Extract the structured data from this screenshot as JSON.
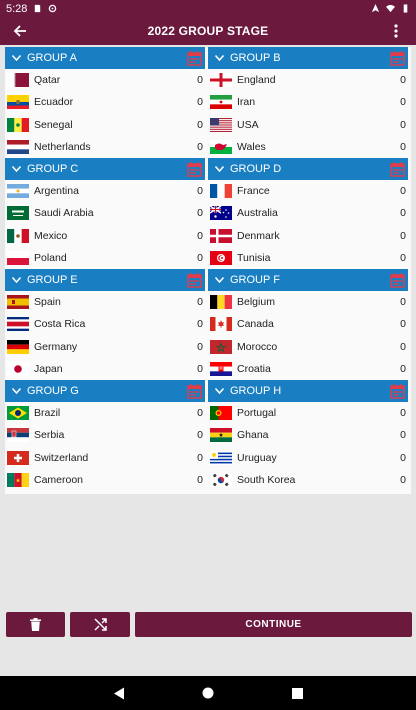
{
  "status_bar": {
    "time": "5:28",
    "left_icons": [
      "sd-card-icon",
      "sync-icon"
    ],
    "right_icons": [
      "location-icon",
      "wifi-icon",
      "battery-icon"
    ]
  },
  "app_bar": {
    "title": "2022 GROUP STAGE",
    "back_icon": "back-arrow-icon",
    "menu_icon": "more-vert-icon"
  },
  "colors": {
    "primary": "#6b1a3e",
    "group_header": "#1a7fc2",
    "calendar_icon": "#c0392b"
  },
  "groups": [
    {
      "name": "GROUP A",
      "teams": [
        {
          "name": "Qatar",
          "score": "0",
          "flag": "qatar"
        },
        {
          "name": "Ecuador",
          "score": "0",
          "flag": "ecuador"
        },
        {
          "name": "Senegal",
          "score": "0",
          "flag": "senegal"
        },
        {
          "name": "Netherlands",
          "score": "0",
          "flag": "netherlands"
        }
      ]
    },
    {
      "name": "GROUP B",
      "teams": [
        {
          "name": "England",
          "score": "0",
          "flag": "england"
        },
        {
          "name": "Iran",
          "score": "0",
          "flag": "iran"
        },
        {
          "name": "USA",
          "score": "0",
          "flag": "usa"
        },
        {
          "name": "Wales",
          "score": "0",
          "flag": "wales"
        }
      ]
    },
    {
      "name": "GROUP C",
      "teams": [
        {
          "name": "Argentina",
          "score": "0",
          "flag": "argentina"
        },
        {
          "name": "Saudi Arabia",
          "score": "0",
          "flag": "saudi"
        },
        {
          "name": "Mexico",
          "score": "0",
          "flag": "mexico"
        },
        {
          "name": "Poland",
          "score": "0",
          "flag": "poland"
        }
      ]
    },
    {
      "name": "GROUP D",
      "teams": [
        {
          "name": "France",
          "score": "0",
          "flag": "france"
        },
        {
          "name": "Australia",
          "score": "0",
          "flag": "australia"
        },
        {
          "name": "Denmark",
          "score": "0",
          "flag": "denmark"
        },
        {
          "name": "Tunisia",
          "score": "0",
          "flag": "tunisia"
        }
      ]
    },
    {
      "name": "GROUP E",
      "teams": [
        {
          "name": "Spain",
          "score": "0",
          "flag": "spain"
        },
        {
          "name": "Costa Rica",
          "score": "0",
          "flag": "costarica"
        },
        {
          "name": "Germany",
          "score": "0",
          "flag": "germany"
        },
        {
          "name": "Japan",
          "score": "0",
          "flag": "japan"
        }
      ]
    },
    {
      "name": "GROUP F",
      "teams": [
        {
          "name": "Belgium",
          "score": "0",
          "flag": "belgium"
        },
        {
          "name": "Canada",
          "score": "0",
          "flag": "canada"
        },
        {
          "name": "Morocco",
          "score": "0",
          "flag": "morocco"
        },
        {
          "name": "Croatia",
          "score": "0",
          "flag": "croatia"
        }
      ]
    },
    {
      "name": "GROUP G",
      "teams": [
        {
          "name": "Brazil",
          "score": "0",
          "flag": "brazil"
        },
        {
          "name": "Serbia",
          "score": "0",
          "flag": "serbia"
        },
        {
          "name": "Switzerland",
          "score": "0",
          "flag": "switzerland"
        },
        {
          "name": "Cameroon",
          "score": "0",
          "flag": "cameroon"
        }
      ]
    },
    {
      "name": "GROUP H",
      "teams": [
        {
          "name": "Portugal",
          "score": "0",
          "flag": "portugal"
        },
        {
          "name": "Ghana",
          "score": "0",
          "flag": "ghana"
        },
        {
          "name": "Uruguay",
          "score": "0",
          "flag": "uruguay"
        },
        {
          "name": "South Korea",
          "score": "0",
          "flag": "southkorea"
        }
      ]
    }
  ],
  "bottom_bar": {
    "delete_icon": "trash-icon",
    "shuffle_icon": "shuffle-icon",
    "continue_label": "CONTINUE"
  },
  "nav_bar": {
    "icons": [
      "back-triangle-icon",
      "home-circle-icon",
      "recents-square-icon"
    ]
  }
}
